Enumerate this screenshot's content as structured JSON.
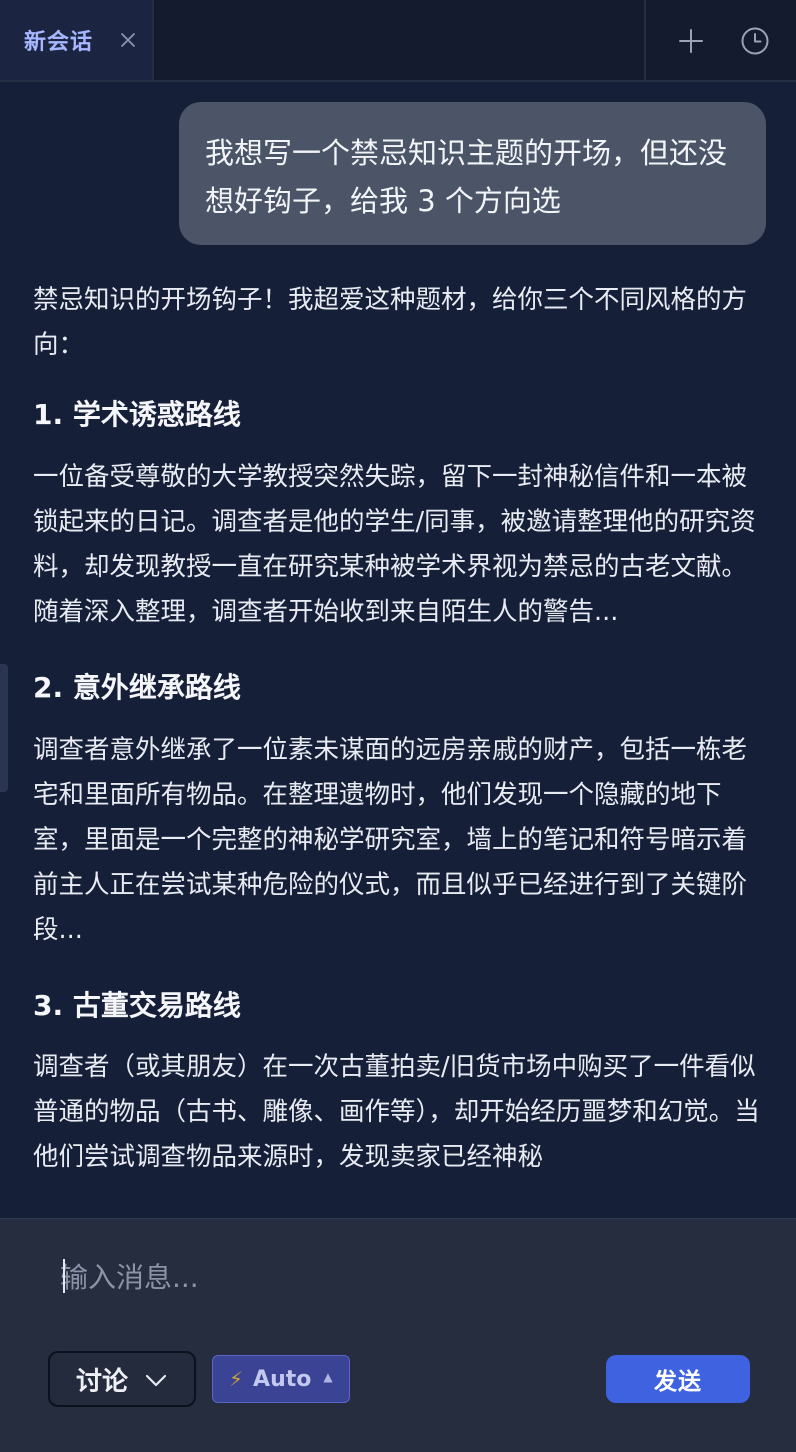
{
  "tab": {
    "title": "新会话"
  },
  "icons": {
    "close": "close-icon",
    "new": "plus-icon",
    "history": "clock-icon",
    "mode_chevron": "chevron-down-icon",
    "model": "lightning-icon"
  },
  "conversation": {
    "user_message": "我想写一个禁忌知识主题的开场，但还没想好钩子，给我 3 个方向选",
    "assistant": {
      "intro": "禁忌知识的开场钩子！我超爱这种题材，给你三个不同风格的方向：",
      "options": [
        {
          "heading": "1. 学术诱惑路线",
          "body": "一位备受尊敬的大学教授突然失踪，留下一封神秘信件和一本被锁起来的日记。调查者是他的学生/同事，被邀请整理他的研究资料，却发现教授一直在研究某种被学术界视为禁忌的古老文献。随着深入整理，调查者开始收到来自陌生人的警告..."
        },
        {
          "heading": "2. 意外继承路线",
          "body": "调查者意外继承了一位素未谋面的远房亲戚的财产，包括一栋老宅和里面所有物品。在整理遗物时，他们发现一个隐藏的地下室，里面是一个完整的神秘学研究室，墙上的笔记和符号暗示着前主人正在尝试某种危险的仪式，而且似乎已经进行到了关键阶段..."
        },
        {
          "heading": "3. 古董交易路线",
          "body": "调查者（或其朋友）在一次古董拍卖/旧货市场中购买了一件看似普通的物品（古书、雕像、画作等），却开始经历噩梦和幻觉。当他们尝试调查物品来源时，发现卖家已经神秘"
        }
      ]
    }
  },
  "composer": {
    "placeholder": "输入消息...",
    "mode": "讨论",
    "model": "Auto",
    "model_arrow": "▲",
    "send_label": "发送"
  },
  "colors": {
    "background": "#161f38",
    "user_bubble": "#4b5567",
    "composer": "#252d3e",
    "accent_tab": "#a7b7ff",
    "send_button": "#3f63e0",
    "model_chip": "#3b4394"
  }
}
